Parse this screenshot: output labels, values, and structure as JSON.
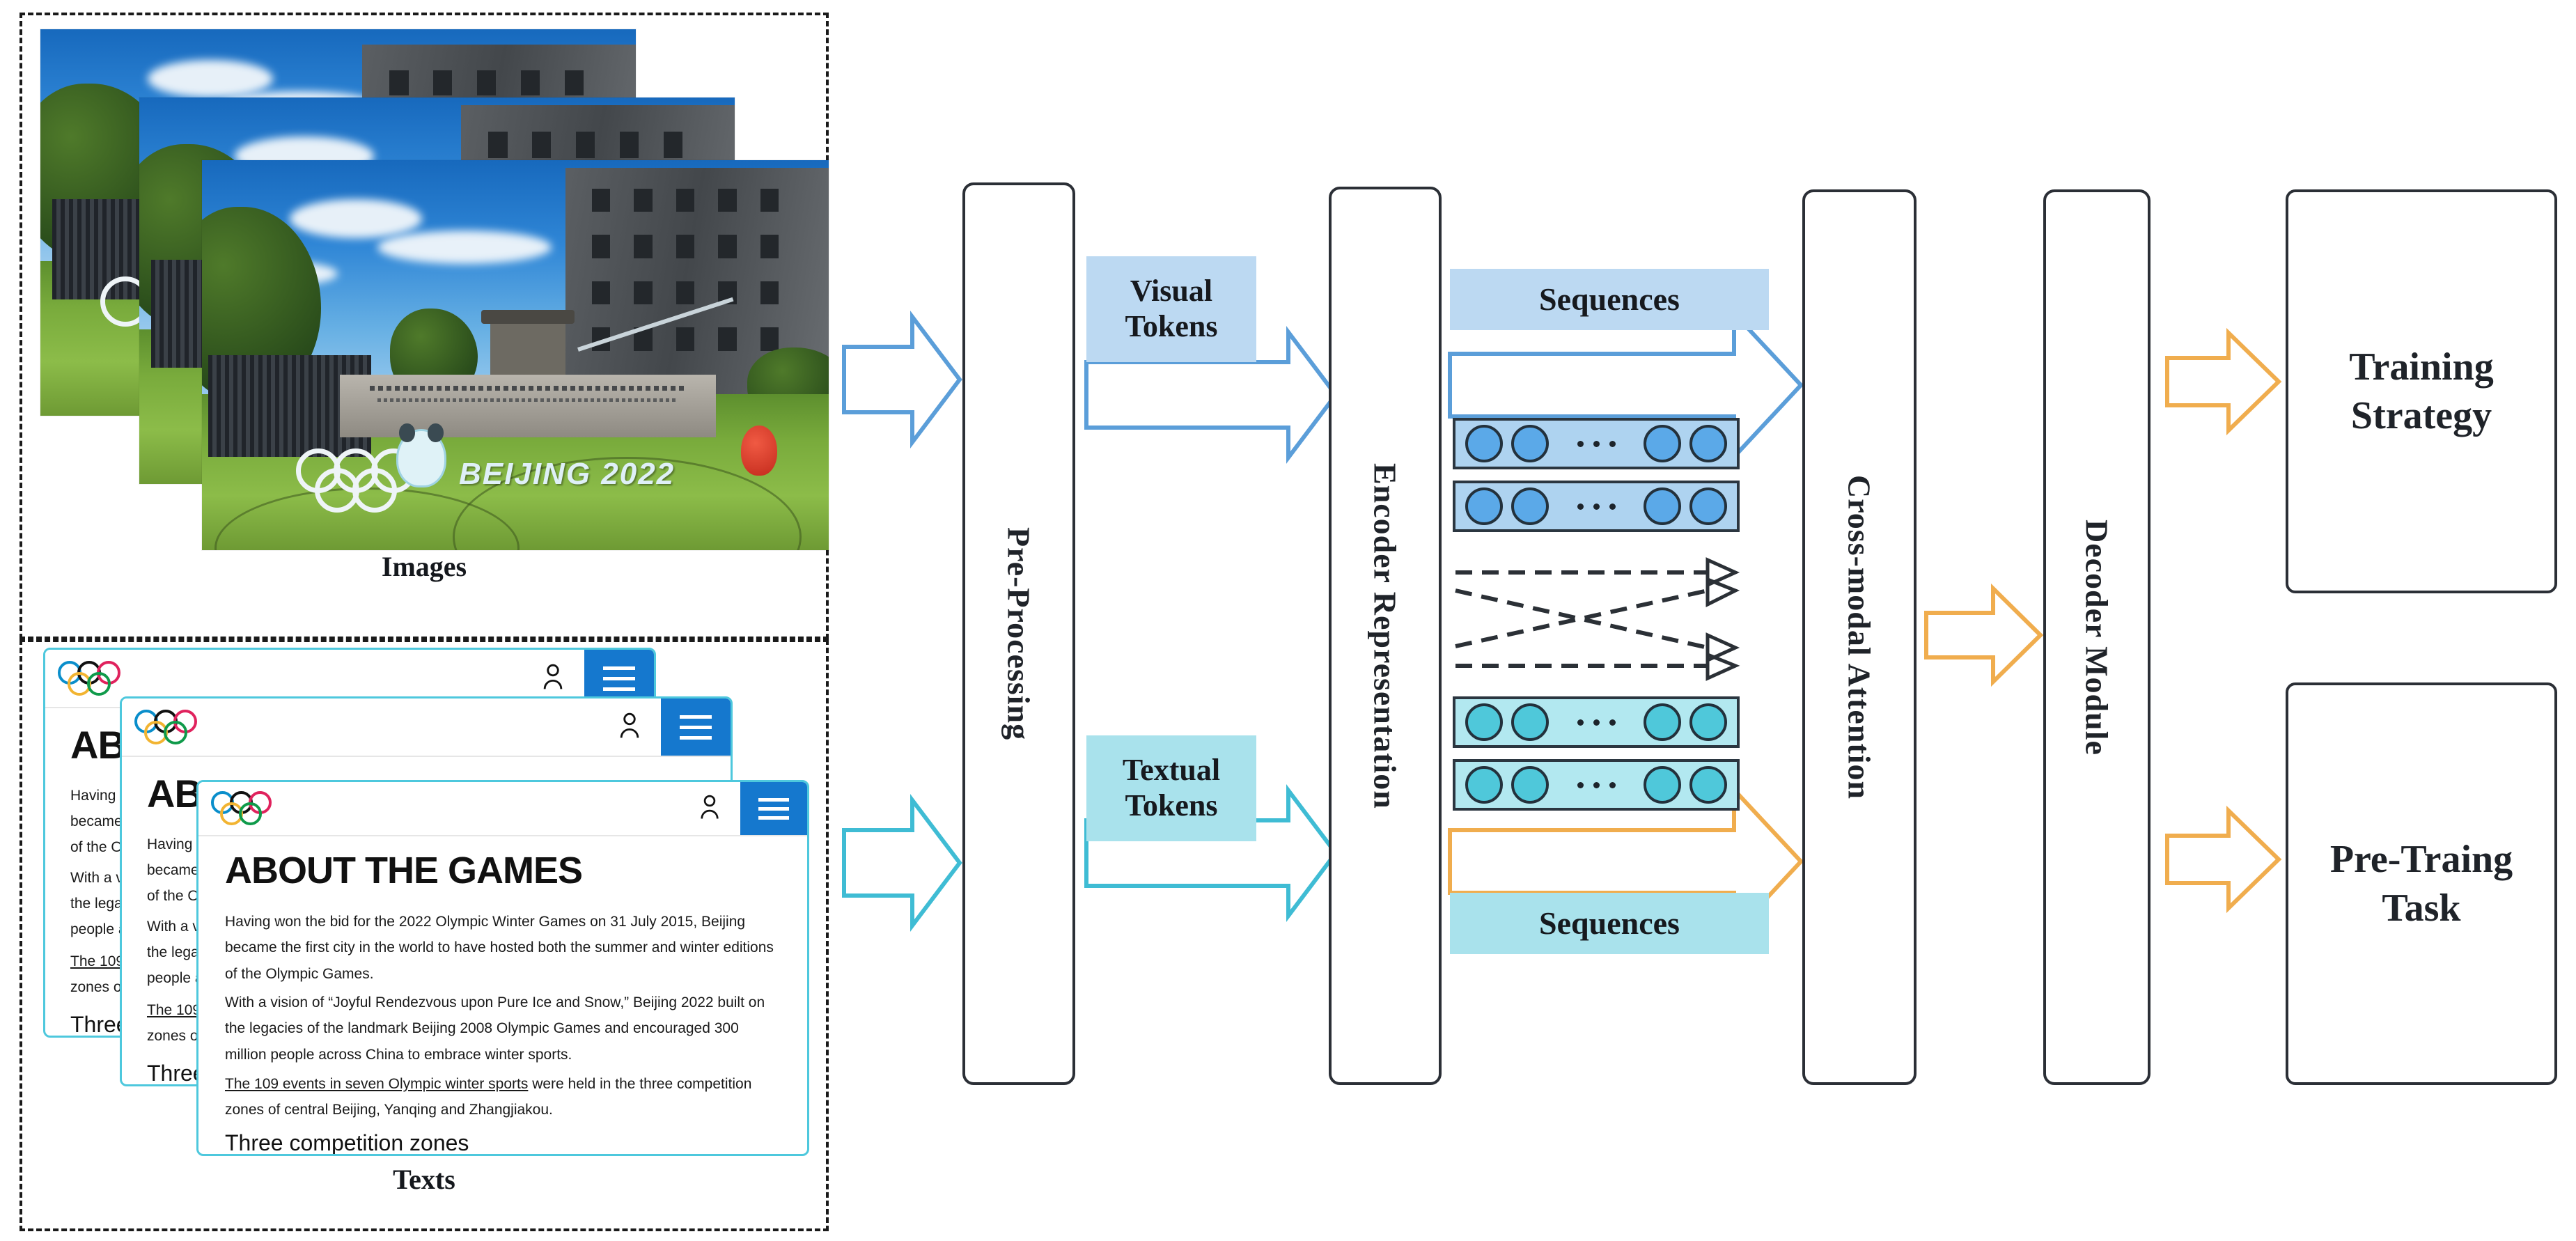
{
  "inputs": {
    "images_group": {
      "caption": "Images",
      "count": 3
    },
    "texts_group": {
      "caption": "Texts",
      "count": 3
    }
  },
  "document_card": {
    "title": "ABOUT THE GAMES",
    "paragraphs": [
      "Having won the bid for the 2022 Olympic Winter Games on 31 July 2015, Beijing became the first city in the world to have hosted both the summer and winter editions of the Olympic Games.",
      "With a vision of “Joyful Rendezvous upon Pure Ice and Snow,” Beijing 2022 built on the legacies of the landmark Beijing 2008 Olympic Games and encouraged 300 million people across China to embrace winter sports."
    ],
    "link_text": "The 109 events in seven Olympic winter sports",
    "link_rest": " were held in the three competition zones of central Beijing, Yanqing and Zhangjiakou.",
    "subheading": "Three competition zones",
    "icons": {
      "logo": "olympic-rings-icon",
      "account": "user-account-icon",
      "menu": "hamburger-menu-icon"
    }
  },
  "photo": {
    "sign_text": "BEIJING 2022"
  },
  "pipeline": {
    "preprocessing": "Pre-Processing",
    "encoder": "Encoder Representation",
    "cross_modal": "Cross-modal Attention",
    "decoder": "Decoder Module"
  },
  "tokens": {
    "visual": "Visual Tokens",
    "textual": "Textual Tokens",
    "sequences_top": "Sequences",
    "sequences_bottom": "Sequences"
  },
  "outputs": {
    "training_strategy": "Training Strategy",
    "pretrain_task": "Pre-Traing Task"
  },
  "colors": {
    "visual_chip_bg": "#bcd9f2",
    "textual_chip_bg": "#a9e2ec",
    "visual_strip_bg": "#aed3f0",
    "visual_token": "#5ba9e8",
    "textual_strip_bg": "#b2e8f0",
    "textual_token": "#4fc8da",
    "arrow_blue": "#5b9ed9",
    "arrow_cyan": "#3fbcd4",
    "arrow_orange": "#f0ad4e",
    "box_border": "#2b2f36",
    "dashed_border": "#1a1a1a",
    "doc_border": "#4ec8dd",
    "burger_blue": "#1578ce"
  },
  "chart_data": {
    "type": "diagram",
    "title": "Multimodal pre-training pipeline",
    "nodes": [
      "Images",
      "Texts",
      "Pre-Processing",
      "Visual Tokens",
      "Textual Tokens",
      "Encoder Representation",
      "Sequences",
      "Cross-modal Attention",
      "Decoder Module",
      "Training Strategy",
      "Pre-Traing Task"
    ],
    "edges": [
      {
        "from": "Images",
        "to": "Pre-Processing",
        "color": "#5b9ed9"
      },
      {
        "from": "Texts",
        "to": "Pre-Processing",
        "color": "#3fbcd4"
      },
      {
        "from": "Visual Tokens",
        "to": "Encoder Representation",
        "color": "#5b9ed9"
      },
      {
        "from": "Textual Tokens",
        "to": "Encoder Representation",
        "color": "#3fbcd4"
      },
      {
        "from": "Sequences (visual)",
        "to": "Cross-modal Attention",
        "color": "#5b9ed9"
      },
      {
        "from": "Sequences (textual)",
        "to": "Cross-modal Attention",
        "color": "#f0ad4e"
      },
      {
        "from": "Cross-modal Attention",
        "to": "Decoder Module",
        "color": "#f0ad4e"
      },
      {
        "from": "Decoder Module",
        "to": "Training Strategy",
        "color": "#f0ad4e"
      },
      {
        "from": "Decoder Module",
        "to": "Pre-Traing Task",
        "color": "#f0ad4e"
      }
    ],
    "token_rows": 4,
    "tokens_per_row": 4,
    "cross_attention_links": 4
  }
}
